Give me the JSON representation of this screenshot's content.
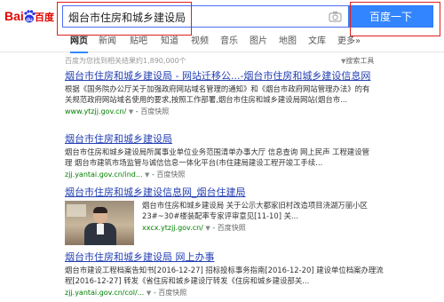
{
  "logo": {
    "text_left": "Bai",
    "text_paw": "du",
    "text_right": "百度"
  },
  "search": {
    "query": "烟台市住房和城乡建设局",
    "button_label": "百度一下"
  },
  "tabs": [
    {
      "label": "网页"
    },
    {
      "label": "新闻"
    },
    {
      "label": "贴吧"
    },
    {
      "label": "知道"
    },
    {
      "label": "视频"
    },
    {
      "label": "音乐"
    },
    {
      "label": "图片"
    },
    {
      "label": "地图"
    },
    {
      "label": "文库"
    },
    {
      "label": "更多»"
    }
  ],
  "result_count": "百度为您找到相关结果约1,890,000个",
  "search_tools": "搜索工具",
  "results": [
    {
      "title": "烟台市住房和城乡建设局 - 网站迁移公...-烟台市住房和城乡建设信息网",
      "desc1": "根据《国务院办公厅关于加强政府网站域名管理的通知》和《烟台市政府网站管理办法》的有",
      "desc2": "关规范政府网站域名使用的要求,按照工作部署,烟台市住房和城乡建设局网站(烟台市...",
      "url": "www.ytzjj.gov.cn/",
      "cache": "百度快照"
    },
    {
      "title": "烟台市住房和城乡建设局",
      "desc1": "烟台市住房和城乡建设局所属事业单位业务范围清单办事大厅 信息查询 网上民声 工程建设管",
      "desc2": "理 烟台市建筑市场监管与诚信信息一体化平台(市住建局建设工程开竣工手续...",
      "url": "zjj.yantai.gov.cn/ind...",
      "cache": "百度快照"
    },
    {
      "title": "烟台市住房和城乡建设信息网_烟台住建局",
      "desc1": "烟台市住房和城乡建设局 关于公示大都家旧村改造项目浇湖万丽小区",
      "desc2": "23#~30#楼装配率专家评审意见[11-10] 关...",
      "url": "xxcx.ytzjj.gov.cn/",
      "cache": "百度快照"
    },
    {
      "title": "烟台市住房和城乡建设局 网上办事",
      "desc1": "烟台市建设工程档案告知书[2016-12-27] 招标投标事务指南[2016-12-20] 建设单位档案办理流",
      "desc2": "程[2016-12-27] 转发《省住房和城乡建设厅转发《住房和城乡建设部关...",
      "url": "zjj.yantai.gov.cn/col/...",
      "cache": "百度快照"
    }
  ]
}
